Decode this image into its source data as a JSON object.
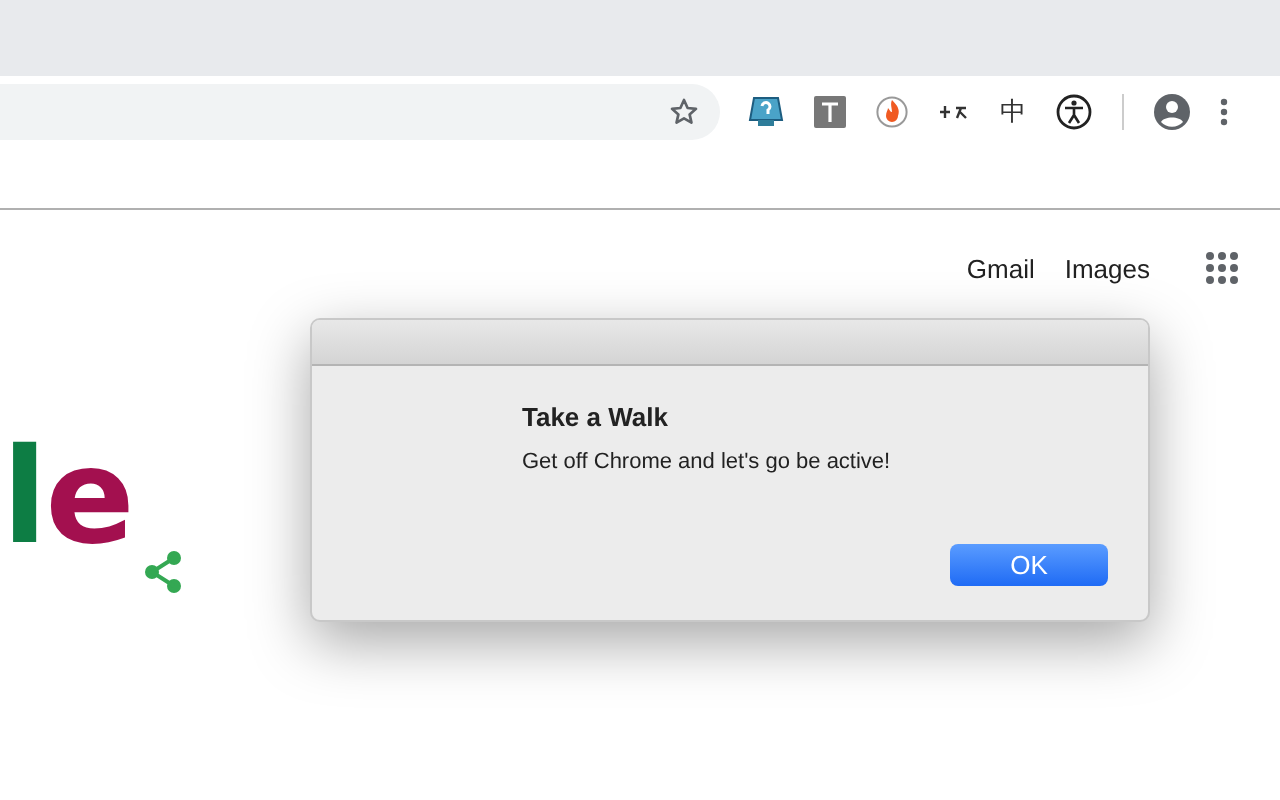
{
  "toolbar": {
    "extension_text": "中"
  },
  "header_links": [
    "Gmail",
    "Images"
  ],
  "logo": {
    "letters": [
      {
        "text": "l",
        "color": "#0d7d44"
      },
      {
        "text": "e",
        "color": "#a3104f"
      }
    ]
  },
  "dialog": {
    "title": "Take a Walk",
    "message": "Get off Chrome and let's go be active!",
    "button": "OK"
  }
}
